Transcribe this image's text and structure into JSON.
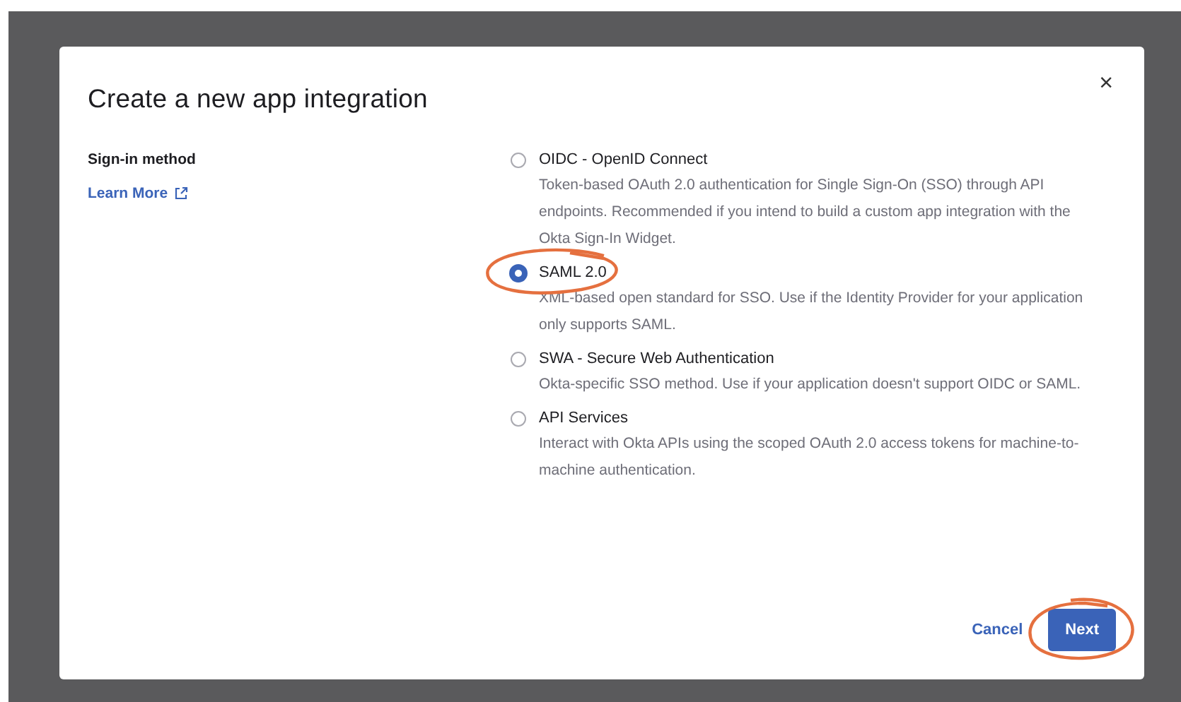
{
  "dialog": {
    "title": "Create a new app integration",
    "close": "×"
  },
  "field": {
    "label": "Sign-in method",
    "link": "Learn More"
  },
  "options": [
    {
      "label": "OIDC - OpenID Connect",
      "description": "Token-based OAuth 2.0 authentication for Single Sign-On (SSO) through API endpoints. Recommended if you intend to build a custom app integration with the Okta Sign-In Widget.",
      "selected": false,
      "circled": false
    },
    {
      "label": "SAML 2.0",
      "description": "XML-based open standard for SSO. Use if the Identity Provider for your application only supports SAML.",
      "selected": true,
      "circled": true
    },
    {
      "label": "SWA - Secure Web Authentication",
      "description": "Okta-specific SSO method. Use if your application doesn't support OIDC or SAML.",
      "selected": false,
      "circled": false
    },
    {
      "label": "API Services",
      "description": "Interact with Okta APIs using the scoped OAuth 2.0 access tokens for machine-to-machine authentication.",
      "selected": false,
      "circled": false
    }
  ],
  "buttons": [
    {
      "label": "Cancel",
      "kind": "link",
      "circled": false
    },
    {
      "label": "Next",
      "kind": "primary",
      "circled": true
    }
  ]
}
